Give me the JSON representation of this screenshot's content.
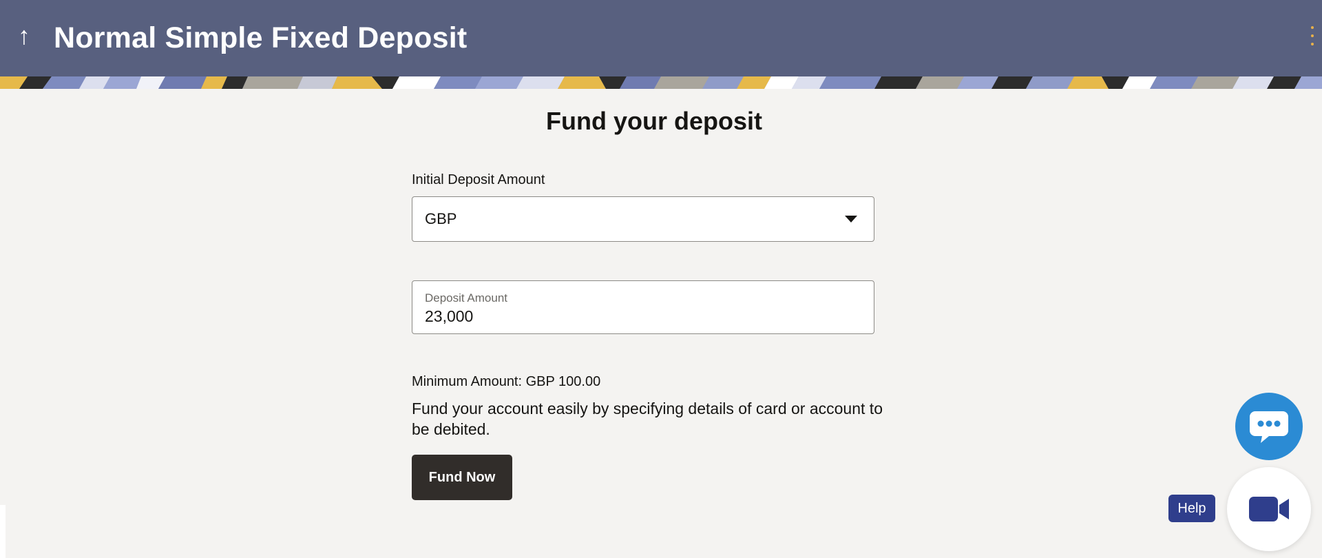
{
  "header": {
    "back_icon": "up-arrow-icon",
    "title": "Normal Simple Fixed Deposit",
    "menu_icon": "kebab-menu-icon"
  },
  "main": {
    "heading": "Fund your deposit",
    "currency_field": {
      "label": "Initial Deposit Amount",
      "value": "GBP"
    },
    "amount_field": {
      "label": "Deposit Amount",
      "value": "23,000"
    },
    "minimum_amount": "Minimum Amount: GBP 100.00",
    "helper_text": "Fund your account easily by specifying details of card or account to be debited.",
    "fund_button": "Fund Now"
  },
  "floating": {
    "chat_icon": "chat-bubble-icon",
    "help_label": "Help",
    "video_icon": "video-camera-icon"
  },
  "colors": {
    "header": "#58607f",
    "primary_button": "#312d2a",
    "chat": "#2b8bd4",
    "help": "#2f3e8c",
    "video_icon": "#2f3e8c",
    "background": "#f4f3f1"
  }
}
